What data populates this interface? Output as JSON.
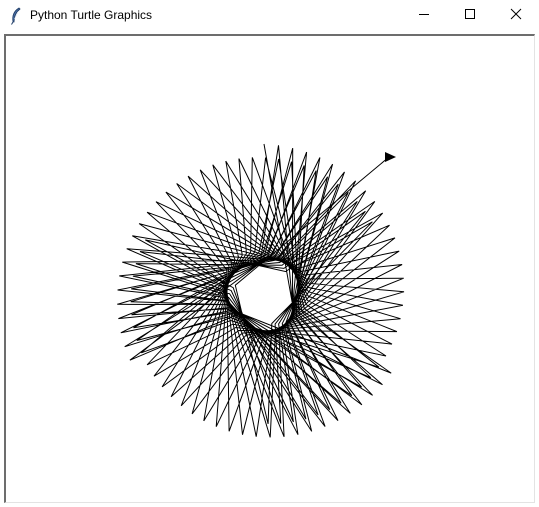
{
  "window": {
    "title": "Python Turtle Graphics",
    "icon": "feather-icon"
  },
  "controls": {
    "minimize_icon": "minimize-icon",
    "maximize_icon": "maximize-icon",
    "close_icon": "close-icon"
  },
  "canvas": {
    "background": "#ffffff",
    "pen_color": "#000000",
    "turtle_icon": "turtle-arrow-icon"
  }
}
